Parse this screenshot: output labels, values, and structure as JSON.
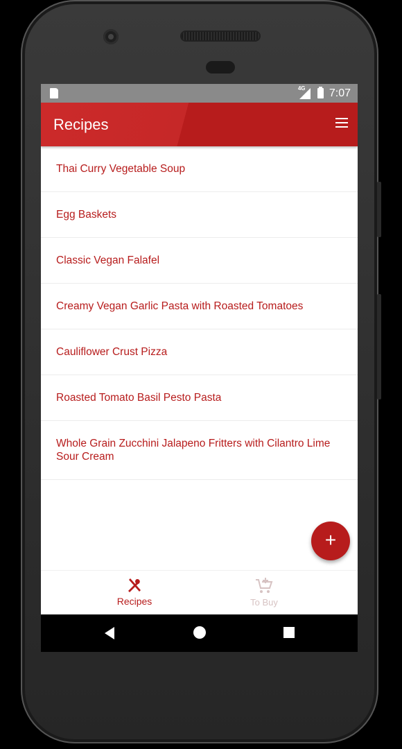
{
  "status_bar": {
    "time": "7:07",
    "network": "4G"
  },
  "app_bar": {
    "title": "Recipes",
    "menu_icon": "hamburger-menu-icon"
  },
  "recipes": [
    "Thai Curry Vegetable Soup",
    "Egg Baskets",
    "Classic Vegan Falafel",
    "Creamy Vegan Garlic Pasta with Roasted Tomatoes",
    "Cauliflower Crust Pizza",
    "Roasted Tomato Basil Pesto Pasta",
    "Whole Grain Zucchini Jalapeno Fritters with Cilantro Lime Sour Cream"
  ],
  "fab": {
    "label": "+",
    "icon": "add-icon"
  },
  "bottom_nav": [
    {
      "label": "Recipes",
      "icon": "fork-knife-icon",
      "selected": true
    },
    {
      "label": "To Buy",
      "icon": "add-to-cart-icon",
      "selected": false
    }
  ],
  "colors": {
    "primary": "#b71c1c",
    "inactive": "#d7c3c3"
  }
}
